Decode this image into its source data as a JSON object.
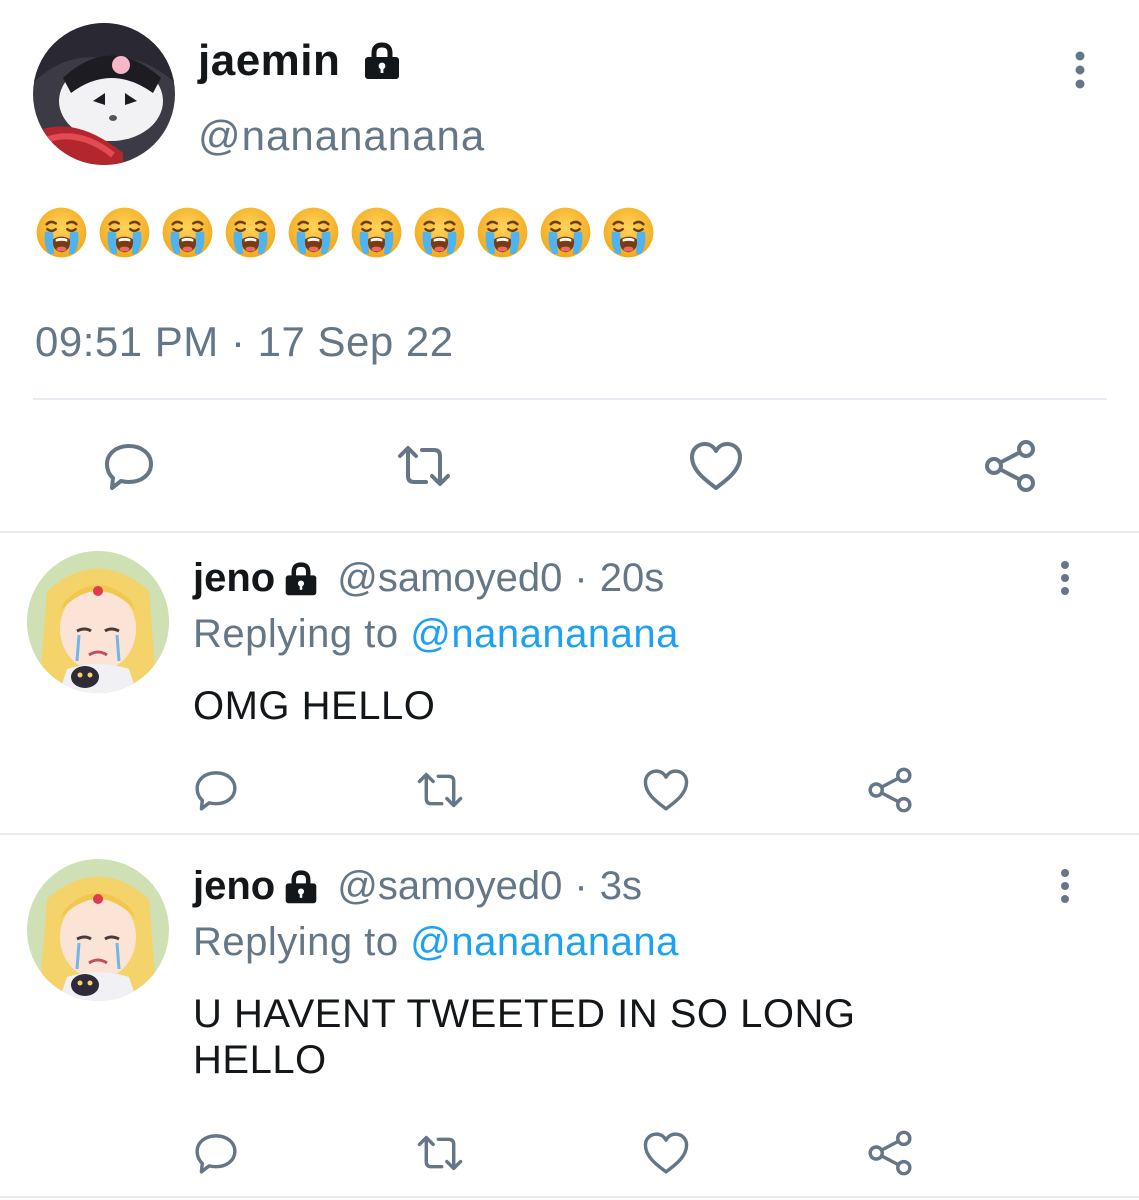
{
  "main_tweet": {
    "display_name": "jaemin",
    "handle": "@nanananana",
    "text_emoji": [
      "😭",
      "😭",
      "😭",
      "😭",
      "😭",
      "😭",
      "😭",
      "😭",
      "😭",
      "😭"
    ],
    "timestamp": "09:51 PM · 17 Sep 22",
    "icons": {
      "lock": "lock-icon",
      "more": "more-vertical-icon",
      "reply": "reply-bubble-icon",
      "retweet": "retweet-icon",
      "like": "heart-icon",
      "share": "share-icon"
    }
  },
  "replies": [
    {
      "display_name": "jeno",
      "handle": "@samoyed0",
      "separator": "·",
      "time": "20s",
      "replying_to_label": "Replying to",
      "replying_to_handle": "@nanananana",
      "text": "OMG HELLO"
    },
    {
      "display_name": "jeno",
      "handle": "@samoyed0",
      "separator": "·",
      "time": "3s",
      "replying_to_label": "Replying to",
      "replying_to_handle": "@nanananana",
      "text": "U HAVENT TWEETED IN SO LONG HELLO"
    }
  ],
  "colors": {
    "text": "#14171a",
    "muted": "#657786",
    "link": "#1da1f2",
    "divider": "#e6ecf0"
  }
}
